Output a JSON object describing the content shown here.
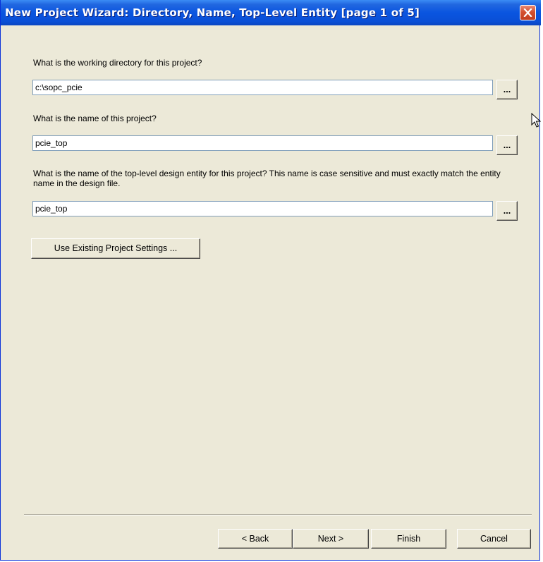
{
  "window": {
    "title": "New Project Wizard: Directory, Name, Top-Level Entity [page 1 of 5]"
  },
  "fields": {
    "directory": {
      "label": "What is the working directory for this project?",
      "value": "c:\\sopc_pcie",
      "browse_label": "..."
    },
    "project_name": {
      "label": "What is the name of this project?",
      "value": "pcie_top",
      "browse_label": "..."
    },
    "top_entity": {
      "label": "What is the name of the top-level design entity for this project? This name is case sensitive and must exactly match the entity name in the design file.",
      "value": "pcie_top",
      "browse_label": "..."
    }
  },
  "use_existing_label": "Use Existing Project Settings ...",
  "footer": {
    "back_label": "< Back",
    "next_label": "Next >",
    "finish_label": "Finish",
    "cancel_label": "Cancel"
  }
}
